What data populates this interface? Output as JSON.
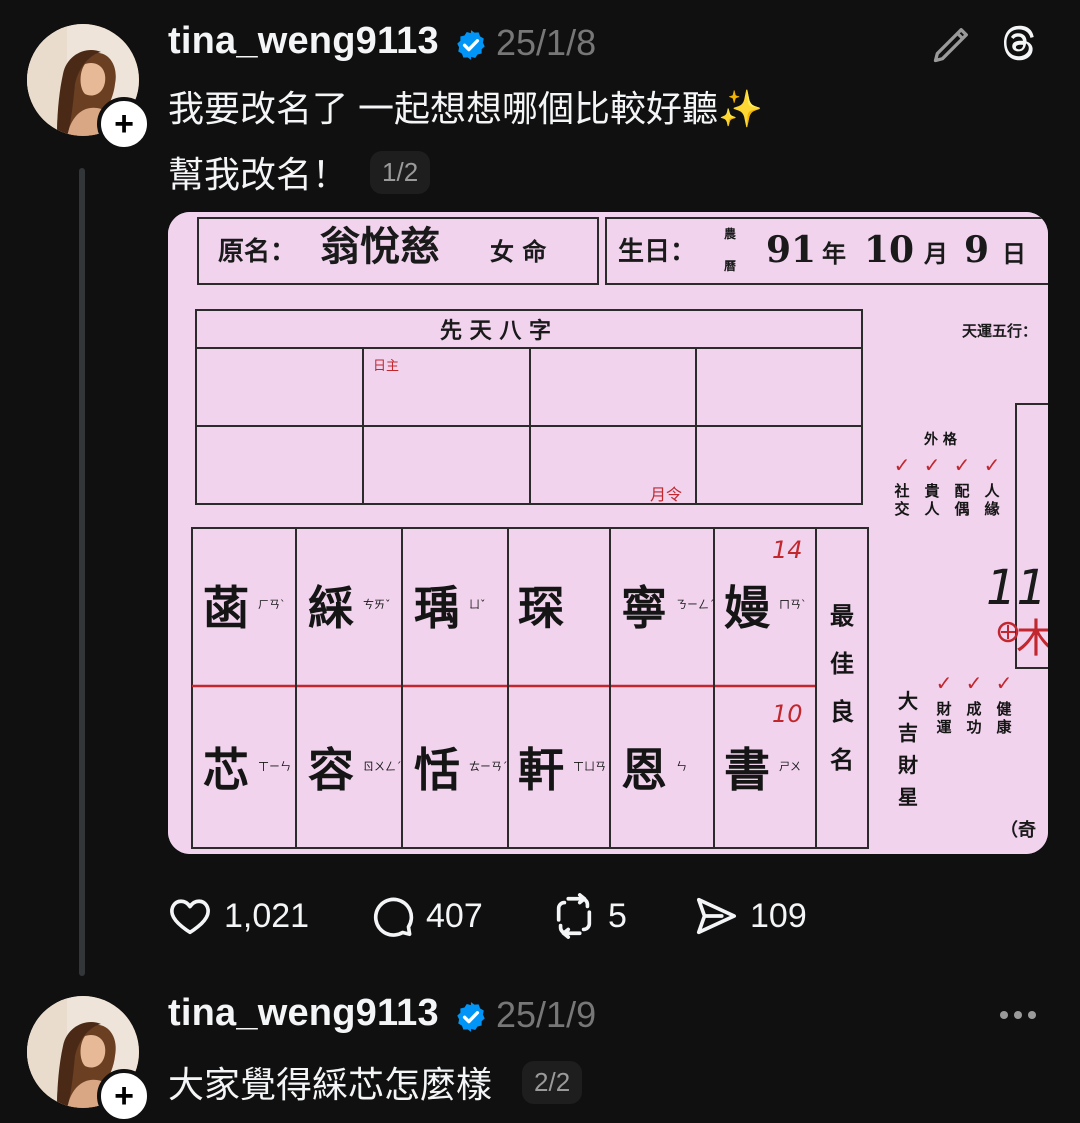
{
  "post1": {
    "username": "tina_weng9113",
    "date": "25/1/8",
    "text": "我要改名了 一起想想哪個比較好聽✨",
    "subtext": "幫我改名！",
    "pager": "1/2",
    "actions": {
      "likes": "1,021",
      "comments": "407",
      "reposts": "5",
      "shares": "109"
    }
  },
  "post2": {
    "username": "tina_weng9113",
    "date": "25/1/9",
    "text": "大家覺得綵芯怎麼樣",
    "pager": "2/2"
  },
  "image": {
    "orig_name_label": "原名：",
    "orig_name": "翁悅慈",
    "gender": "女 命",
    "birthday_label": "生日：",
    "calendar_top": "農",
    "calendar_bottom": "曆",
    "birth_year": "91",
    "year_label": "年",
    "birth_month": "10",
    "month_label": "月",
    "birth_day": "9",
    "day_label": "日",
    "bazi_title": "先  天  八  字",
    "day_master_note": "日主",
    "month_order_note": "月令",
    "wuxing_label": "天運五行：",
    "row1_chars": [
      "菡",
      "綵",
      "瑀",
      "琛",
      "寧",
      "嫚"
    ],
    "row1_zhuyin": [
      "ㄏㄢˋ",
      "ㄘㄞˇ",
      "ㄩˇ",
      "",
      "ㄋㄧㄥˊ",
      "ㄇㄢˋ"
    ],
    "row2_chars": [
      "芯",
      "容",
      "恬",
      "軒",
      "恩",
      "書"
    ],
    "row2_zhuyin": [
      "ㄒㄧㄣ",
      "ㄖㄨㄥˊ",
      "ㄊㄧㄢˊ",
      "ㄒㄩㄢ",
      "ㄣ",
      "ㄕㄨ"
    ],
    "note_14": "14",
    "note_10": "10",
    "best_name_label": "最佳良名",
    "checks_top_header": "外 格",
    "checks_top": [
      "社交",
      "貴人",
      "配偶",
      "人緣"
    ],
    "great_luck_label": "大吉財星",
    "checks_bottom": [
      "財運",
      "成功",
      "健康"
    ],
    "handwriting": "11",
    "wood_char": "木",
    "corner_text": "（奇"
  },
  "icons": {
    "verified": "verified-badge-icon",
    "edit": "pencil-icon",
    "threads": "threads-logo-icon",
    "more": "more-dots-icon"
  },
  "colors": {
    "background": "#101010",
    "verified": "#0095f6",
    "muted": "#777777",
    "paper": "#f1d3ee",
    "check_red": "#c1272d"
  }
}
